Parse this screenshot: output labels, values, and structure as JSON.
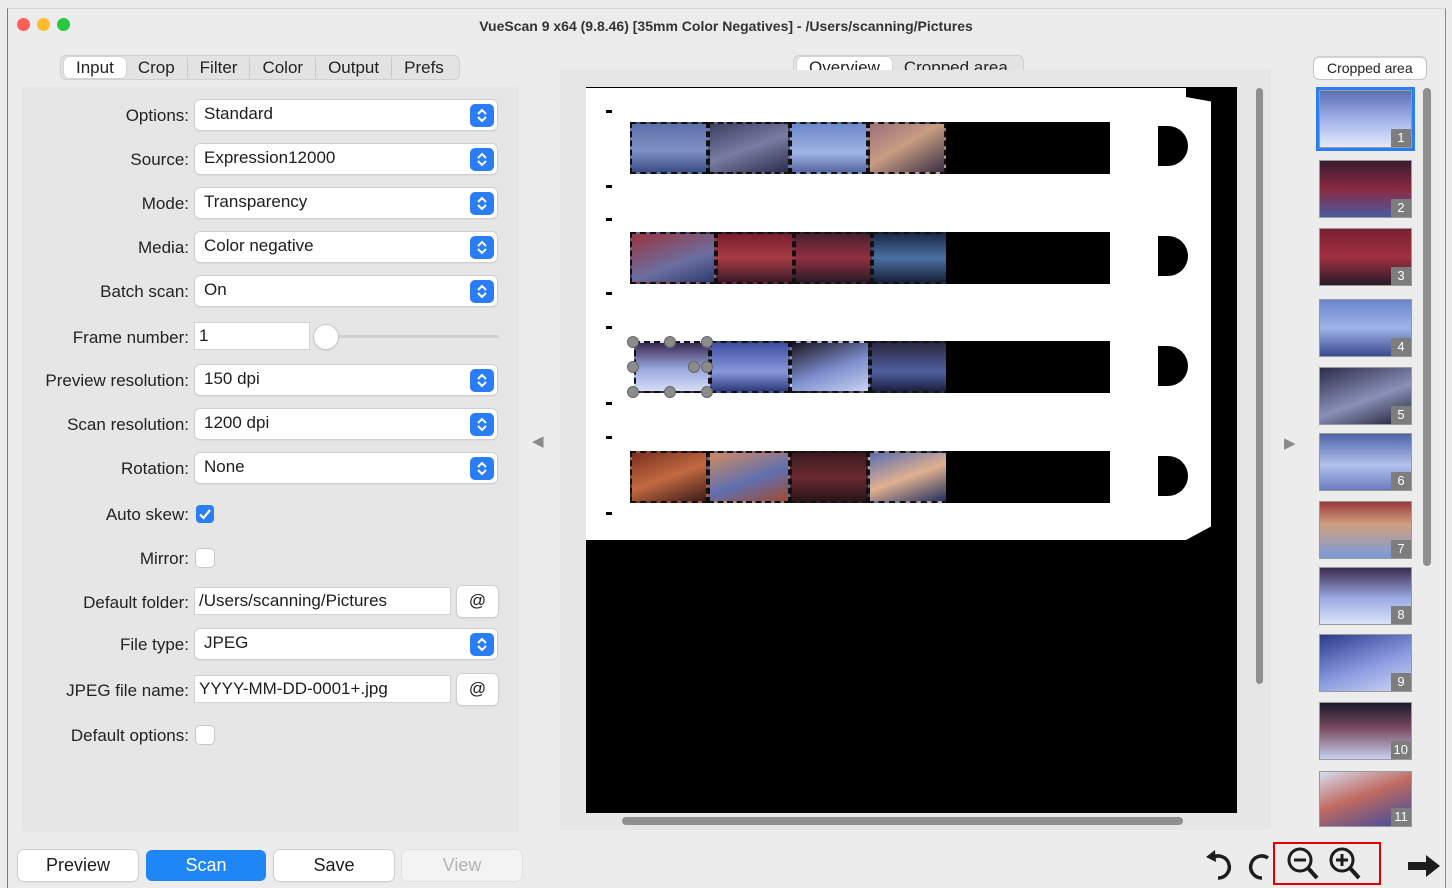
{
  "window": {
    "title": "VueScan 9 x64 (9.8.46) [35mm Color Negatives] - /Users/scanning/Pictures"
  },
  "left_tabs": [
    "Input",
    "Crop",
    "Filter",
    "Color",
    "Output",
    "Prefs"
  ],
  "center_tabs": [
    "Overview",
    "Cropped area"
  ],
  "right_tab": "Cropped area",
  "settings": {
    "options": {
      "label": "Options:",
      "value": "Standard"
    },
    "source": {
      "label": "Source:",
      "value": "Expression12000"
    },
    "mode": {
      "label": "Mode:",
      "value": "Transparency"
    },
    "media": {
      "label": "Media:",
      "value": "Color negative"
    },
    "batch_scan": {
      "label": "Batch scan:",
      "value": "On"
    },
    "frame_number": {
      "label": "Frame number:",
      "value": "1"
    },
    "preview_res": {
      "label": "Preview resolution:",
      "value": "150 dpi"
    },
    "scan_res": {
      "label": "Scan resolution:",
      "value": "1200 dpi"
    },
    "rotation": {
      "label": "Rotation:",
      "value": "None"
    },
    "auto_skew": {
      "label": "Auto skew:",
      "checked": true
    },
    "mirror": {
      "label": "Mirror:",
      "checked": false
    },
    "default_folder": {
      "label": "Default folder:",
      "value": "/Users/scanning/Pictures"
    },
    "file_type": {
      "label": "File type:",
      "value": "JPEG"
    },
    "jpeg_name": {
      "label": "JPEG file name:",
      "value": "YYYY-MM-DD-0001+.jpg"
    },
    "default_options": {
      "label": "Default options:",
      "checked": false
    },
    "at_symbol": "@"
  },
  "buttons": {
    "preview": "Preview",
    "scan": "Scan",
    "save": "Save",
    "view": "View"
  },
  "thumbnails": [
    "1",
    "2",
    "3",
    "4",
    "5",
    "6",
    "7",
    "8",
    "9",
    "10",
    "11"
  ],
  "colors": {
    "accent": "#2a7df4",
    "scan_button": "#1f86f6",
    "highlight_box": "#e00000"
  },
  "toolbar_icons": [
    "rotate-left-icon",
    "rotate-right-icon",
    "zoom-out-icon",
    "zoom-in-icon",
    "arrow-right-icon"
  ]
}
